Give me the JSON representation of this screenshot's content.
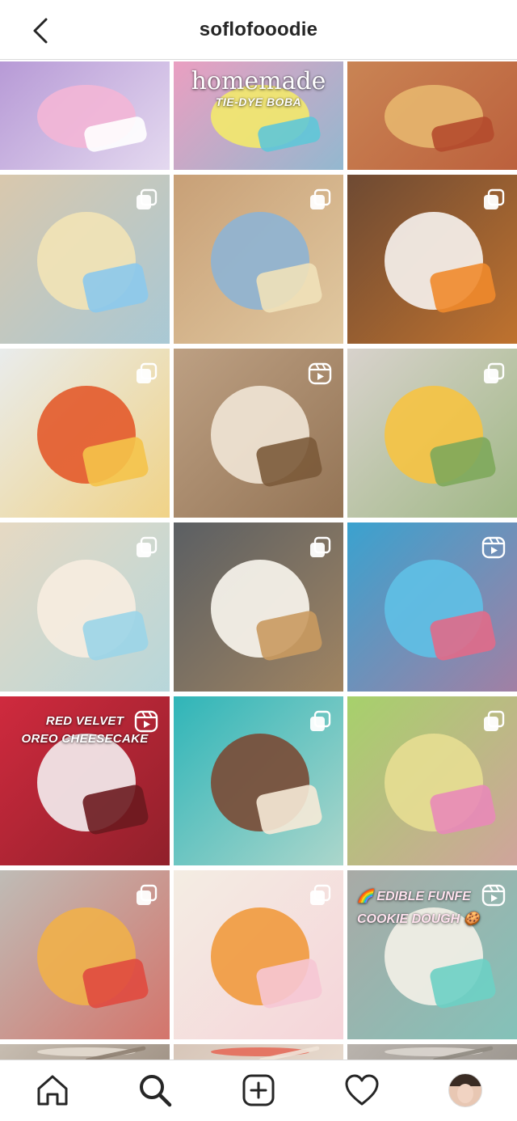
{
  "header": {
    "username": "soflofooodie",
    "back_icon": "chevron-left-icon"
  },
  "grid": {
    "tiles": [
      {
        "name": "post-tie-dye-ice-cream",
        "bg": "#b79ad6",
        "accent": "#f3b6d6",
        "accent2": "#ffffff",
        "badge": "none"
      },
      {
        "name": "post-tie-dye-boba",
        "bg": "#ea9fc1",
        "accent": "#f3e96b",
        "accent2": "#5fc7d8",
        "badge": "none"
      },
      {
        "name": "post-lasagna",
        "bg": "#c98454",
        "accent": "#e7b66e",
        "accent2": "#b44b2e",
        "badge": "none"
      },
      {
        "name": "post-popcorn-balls",
        "bg": "#d9c8ad",
        "accent": "#f2e3b6",
        "accent2": "#8cc9ec",
        "badge": "carousel"
      },
      {
        "name": "post-blue-fudge",
        "bg": "#c8a077",
        "accent": "#8eb4d4",
        "accent2": "#f0e1b9",
        "badge": "carousel"
      },
      {
        "name": "post-peeps-smores",
        "bg": "#6e4a33",
        "accent": "#f7f3ef",
        "accent2": "#ef8a2c",
        "badge": "carousel"
      },
      {
        "name": "post-hot-cheetos-snack",
        "bg": "#e9ecec",
        "accent": "#e35a2b",
        "accent2": "#f4c34a",
        "badge": "carousel"
      },
      {
        "name": "post-cookie-butter-shake",
        "bg": "#bda083",
        "accent": "#f1e6d6",
        "accent2": "#7b5a3a",
        "badge": "reel"
      },
      {
        "name": "post-avocado-toast",
        "bg": "#d8d2cc",
        "accent": "#f6c342",
        "accent2": "#7ea85b",
        "badge": "carousel"
      },
      {
        "name": "post-rice-krispie-treats",
        "bg": "#e6d9c3",
        "accent": "#f7ede0",
        "accent2": "#9bd5e8",
        "badge": "carousel"
      },
      {
        "name": "post-ice-cream-cone",
        "bg": "#5b5f63",
        "accent": "#fbf7f0",
        "accent2": "#c99a60",
        "badge": "carousel"
      },
      {
        "name": "post-cotton-candy",
        "bg": "#3aa2cf",
        "accent": "#5fc0e6",
        "accent2": "#e06b8a",
        "badge": "reel"
      },
      {
        "name": "post-red-velvet-cheesecake",
        "bg": "#cf2a3e",
        "accent": "#f4eef0",
        "accent2": "#6b1a1f",
        "badge": "reel"
      },
      {
        "name": "post-cupcakes-piping",
        "bg": "#2fb5b8",
        "accent": "#7a4a35",
        "accent2": "#f6ead7",
        "badge": "carousel"
      },
      {
        "name": "post-lucky-charms-mix",
        "bg": "#a6d16b",
        "accent": "#e7de92",
        "accent2": "#e889b8",
        "badge": "carousel"
      },
      {
        "name": "post-fruity-pebbles-bar",
        "bg": "#bfbcb6",
        "accent": "#f0b04a",
        "accent2": "#e04a3f",
        "badge": "carousel"
      },
      {
        "name": "post-easter-chocolate-box",
        "bg": "#f4ede3",
        "accent": "#f19a3e",
        "accent2": "#f6c6d4",
        "badge": "carousel"
      },
      {
        "name": "post-funfetti-cookie-dough",
        "bg": "#a9aaa6",
        "accent": "#f4f1e8",
        "accent2": "#6dd0c4",
        "badge": "reel"
      },
      {
        "name": "post-partial-1",
        "bg": "#c7bdb1",
        "accent": "#e4dcd0",
        "accent2": "#8d7e70",
        "badge": "none"
      },
      {
        "name": "post-partial-2",
        "bg": "#d7c6b9",
        "accent": "#e46b5a",
        "accent2": "#f0e4d8",
        "badge": "none"
      },
      {
        "name": "post-partial-3",
        "bg": "#b9b3ad",
        "accent": "#dcd6cf",
        "accent2": "#8f8981",
        "badge": "none"
      }
    ],
    "overlays": {
      "boba_line1": "homemade",
      "boba_line2": "TIE-DYE BOBA",
      "cheesecake_line1": "RED VELVET",
      "cheesecake_line2": "OREO CHEESECAKE",
      "cookie_line1": "🌈 EDIBLE FUNFE",
      "cookie_line2": "COOKIE DOUGH 🍪"
    }
  },
  "tabbar": {
    "items": [
      {
        "name": "tab-home",
        "icon": "home-icon"
      },
      {
        "name": "tab-search",
        "icon": "search-icon"
      },
      {
        "name": "tab-create",
        "icon": "plus-square-icon"
      },
      {
        "name": "tab-activity",
        "icon": "heart-icon"
      },
      {
        "name": "tab-profile",
        "icon": "avatar"
      }
    ]
  }
}
